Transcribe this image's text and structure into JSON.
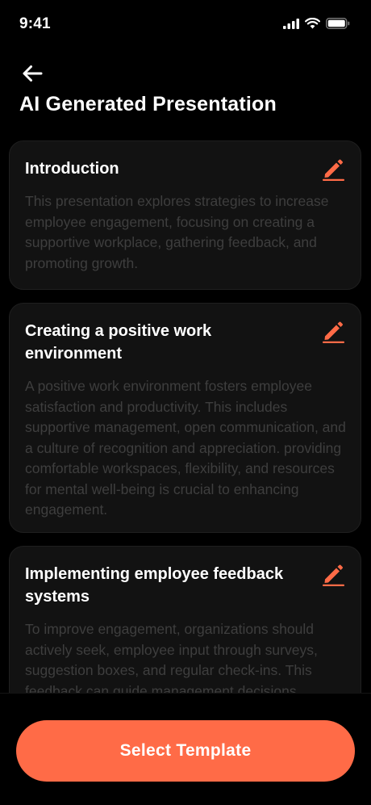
{
  "status_bar": {
    "time": "9:41",
    "icons": [
      "cellular-signal-icon",
      "wifi-icon",
      "battery-icon"
    ]
  },
  "header": {
    "back_icon": "arrow-left-icon",
    "title": "AI Generated Presentation"
  },
  "colors": {
    "background": "#000000",
    "card": "#121212",
    "accent": "#ff6b47",
    "body_text": "#3e3e3e",
    "title_text": "#ffffff"
  },
  "sections": [
    {
      "title": "Introduction",
      "body": "This presentation explores strategies to increase employee engagement, focusing on creating a supportive workplace, gathering feedback, and promoting growth.",
      "edit_icon": "pencil-icon"
    },
    {
      "title": "Creating a positive work environment",
      "body": "A positive work environment fosters employee satisfaction and productivity. This includes supportive management, open communication, and a culture of recognition and appreciation. providing comfortable workspaces, flexibility, and resources for mental well-being is crucial to enhancing engagement.",
      "edit_icon": "pencil-icon"
    },
    {
      "title": "Implementing employee feedback systems",
      "body": "To improve engagement, organizations should actively seek, employee input through surveys, suggestion boxes, and regular check-ins. This feedback can guide management decisions",
      "edit_icon": "pencil-icon"
    }
  ],
  "footer": {
    "button_label": "Select Template"
  }
}
